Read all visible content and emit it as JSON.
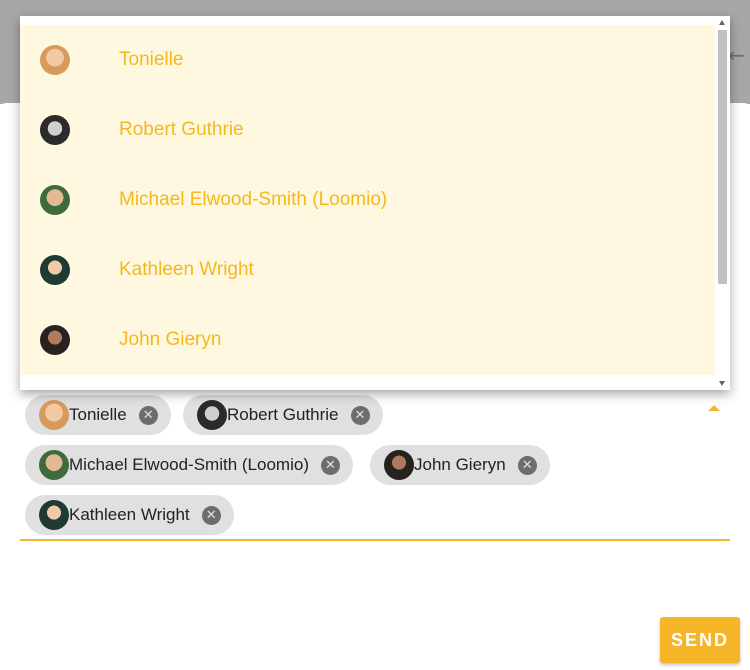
{
  "menu": {
    "items": [
      {
        "label": "Tonielle",
        "avatar": "tonielle-avatar"
      },
      {
        "label": "Robert Guthrie",
        "avatar": "robert-guthrie-avatar"
      },
      {
        "label": "Michael Elwood-Smith (Loomio)",
        "avatar": "michael-elwood-smith-avatar"
      },
      {
        "label": "Kathleen Wright",
        "avatar": "kathleen-wright-avatar"
      },
      {
        "label": "John Gieryn",
        "avatar": "john-gieryn-avatar"
      }
    ]
  },
  "chips": [
    {
      "label": "Tonielle",
      "remove_icon": "close-circle-icon"
    },
    {
      "label": "Robert Guthrie",
      "remove_icon": "close-circle-icon"
    },
    {
      "label": "Michael Elwood-Smith (Loomio)",
      "remove_icon": "close-circle-icon"
    },
    {
      "label": "John Gieryn",
      "remove_icon": "close-circle-icon"
    },
    {
      "label": "Kathleen Wright",
      "remove_icon": "close-circle-icon"
    }
  ],
  "send_label": "SEND",
  "colors": {
    "accent": "#f6b428",
    "menu_text": "#f4b81c",
    "menu_highlight": "#fff8e1",
    "chip_bg": "#e0e0e0"
  },
  "icons": {
    "reply": "reply-arrow-icon",
    "dropdown_toggle": "caret-up-icon"
  }
}
